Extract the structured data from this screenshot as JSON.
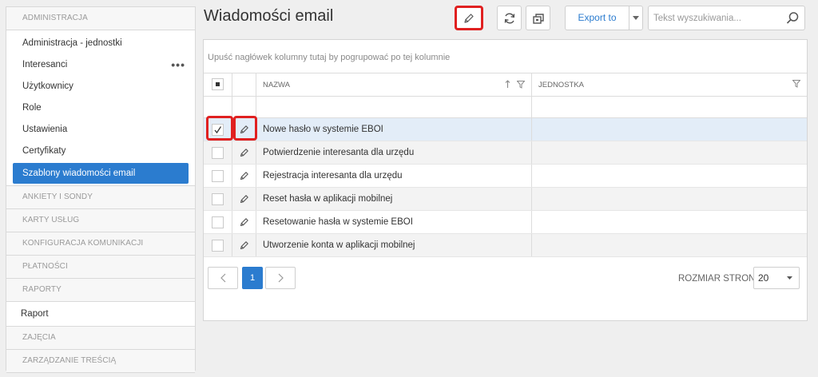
{
  "sidebar": {
    "sections": [
      {
        "title": "ADMINISTRACJA",
        "items": [
          {
            "label": "Administracja - jednostki"
          },
          {
            "label": "Interesanci",
            "more": "•••"
          },
          {
            "label": "Użytkownicy"
          },
          {
            "label": "Role"
          },
          {
            "label": "Ustawienia"
          },
          {
            "label": "Certyfikaty"
          },
          {
            "label": "Szablony wiadomości email",
            "active": true
          }
        ]
      },
      {
        "title": "ANKIETY I SONDY"
      },
      {
        "title": "KARTY USŁUG"
      },
      {
        "title": "KONFIGURACJA KOMUNIKACJI"
      },
      {
        "title": "PŁATNOŚCI"
      },
      {
        "title": "RAPORTY",
        "items": [
          {
            "label": "Raport"
          }
        ]
      },
      {
        "title": "ZAJĘCIA"
      },
      {
        "title": "ZARZĄDZANIE TREŚCIĄ"
      }
    ]
  },
  "header": {
    "title": "Wiadomości email",
    "export_label": "Export to",
    "search_placeholder": "Tekst wyszukiwania..."
  },
  "grid": {
    "group_hint": "Upuść nagłówek kolumny tutaj by pogrupować po tej kolumnie",
    "columns": {
      "name": "NAZWA",
      "unit": "JEDNOSTKA"
    },
    "rows": [
      {
        "name": "Nowe hasło w systemie EBOI",
        "unit": "",
        "checked": true,
        "selected": true
      },
      {
        "name": "Potwierdzenie interesanta dla urzędu",
        "unit": ""
      },
      {
        "name": "Rejestracja interesanta dla urzędu",
        "unit": ""
      },
      {
        "name": "Reset hasła w aplikacji mobilnej",
        "unit": ""
      },
      {
        "name": "Resetowanie hasła w systemie EBOI",
        "unit": ""
      },
      {
        "name": "Utworzenie konta w aplikacji mobilnej",
        "unit": ""
      }
    ]
  },
  "pager": {
    "current_page": "1",
    "page_size_label": "ROZMIAR STRONY",
    "page_size": "20"
  },
  "colors": {
    "accent": "#2b7ccf",
    "highlight": "#e02020",
    "selected_row": "#e3edf8"
  }
}
